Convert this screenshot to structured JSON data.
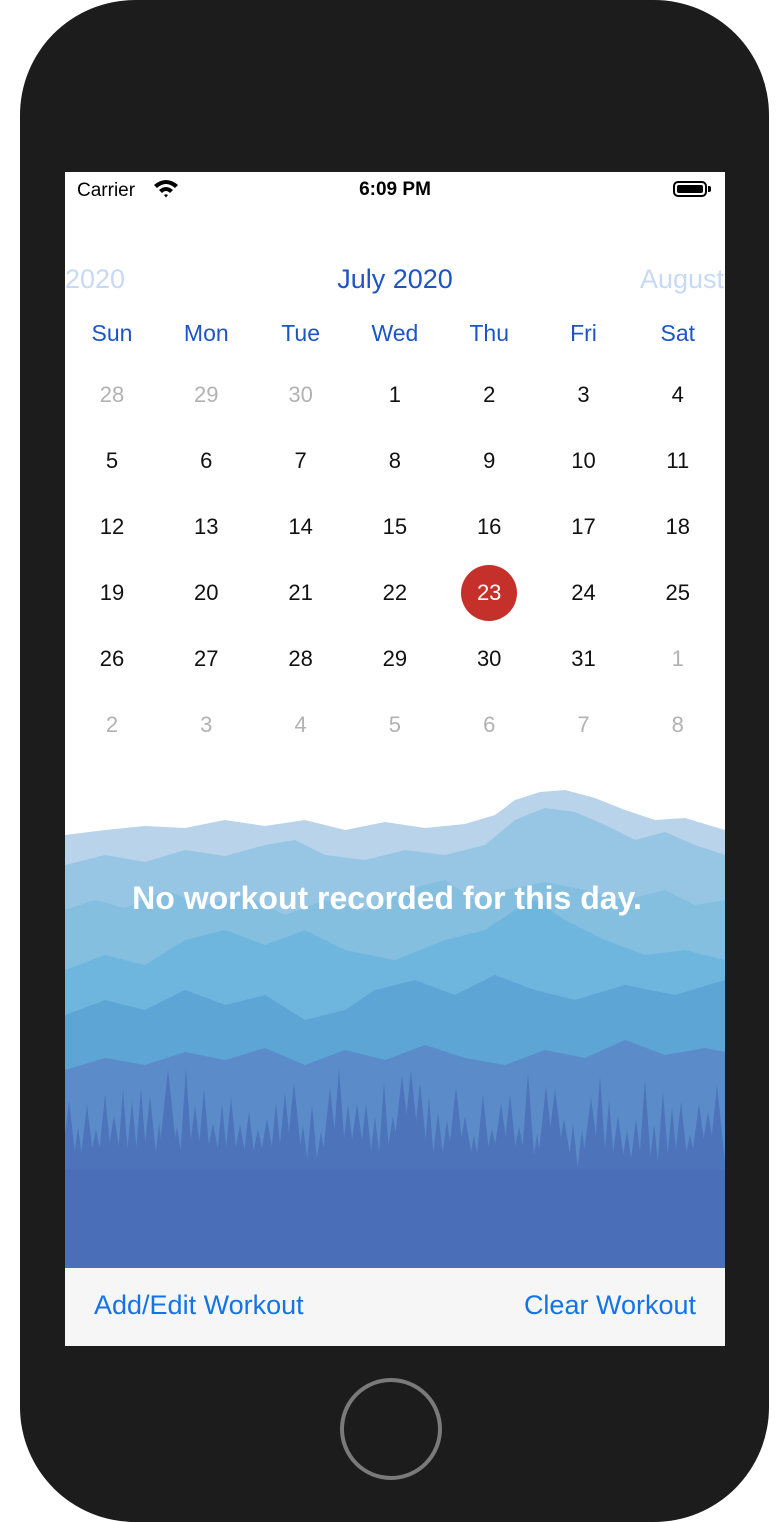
{
  "status_bar": {
    "carrier": "Carrier",
    "time": "6:09 PM",
    "icons": [
      "wifi-icon",
      "battery-icon"
    ]
  },
  "calendar": {
    "prev_month_label": "2020",
    "current_month_label": "July 2020",
    "next_month_label": "August",
    "weekdays": [
      "Sun",
      "Mon",
      "Tue",
      "Wed",
      "Thu",
      "Fri",
      "Sat"
    ],
    "weeks": [
      [
        {
          "d": "28",
          "out": true
        },
        {
          "d": "29",
          "out": true
        },
        {
          "d": "30",
          "out": true
        },
        {
          "d": "1"
        },
        {
          "d": "2"
        },
        {
          "d": "3"
        },
        {
          "d": "4"
        }
      ],
      [
        {
          "d": "5"
        },
        {
          "d": "6"
        },
        {
          "d": "7"
        },
        {
          "d": "8"
        },
        {
          "d": "9"
        },
        {
          "d": "10"
        },
        {
          "d": "11"
        }
      ],
      [
        {
          "d": "12"
        },
        {
          "d": "13"
        },
        {
          "d": "14"
        },
        {
          "d": "15"
        },
        {
          "d": "16"
        },
        {
          "d": "17"
        },
        {
          "d": "18"
        }
      ],
      [
        {
          "d": "19"
        },
        {
          "d": "20"
        },
        {
          "d": "21"
        },
        {
          "d": "22"
        },
        {
          "d": "23",
          "selected": true
        },
        {
          "d": "24"
        },
        {
          "d": "25"
        }
      ],
      [
        {
          "d": "26"
        },
        {
          "d": "27"
        },
        {
          "d": "28"
        },
        {
          "d": "29"
        },
        {
          "d": "30"
        },
        {
          "d": "31"
        },
        {
          "d": "1",
          "out": true
        }
      ],
      [
        {
          "d": "2",
          "out": true
        },
        {
          "d": "3",
          "out": true
        },
        {
          "d": "4",
          "out": true
        },
        {
          "d": "5",
          "out": true
        },
        {
          "d": "6",
          "out": true
        },
        {
          "d": "7",
          "out": true
        },
        {
          "d": "8",
          "out": true
        }
      ]
    ],
    "selected_color": "#c5312a",
    "accent_color": "#1c55c4"
  },
  "workout": {
    "empty_message": "No workout recorded for this day."
  },
  "toolbar": {
    "add_edit_label": "Add/Edit Workout",
    "clear_label": "Clear Workout",
    "accent_color": "#1474e6"
  }
}
